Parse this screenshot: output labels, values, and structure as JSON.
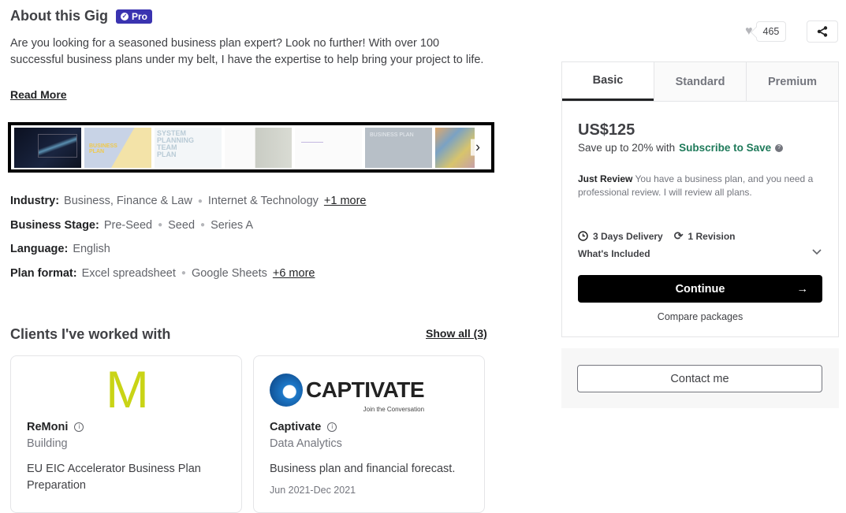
{
  "about": {
    "title": "About this Gig",
    "badge": "Pro",
    "description": "Are you looking for a seasoned business plan expert? Look no further! With over 100 successful business plans under my belt, I have the expertise to help bring your project to life.",
    "read_more": "Read More"
  },
  "gallery": {
    "thumbnails": [
      "video-trading-chart",
      "business-plan-cover",
      "word-cloud-plan",
      "investment-proposal",
      "product-traction-doc",
      "business-plan-startup",
      "risk-management"
    ],
    "next_icon": "chevron-right-icon"
  },
  "attributes": [
    {
      "label": "Industry:",
      "values": [
        "Business, Finance & Law",
        "Internet & Technology"
      ],
      "more": "+1 more"
    },
    {
      "label": "Business Stage:",
      "values": [
        "Pre-Seed",
        "Seed",
        "Series A"
      ],
      "more": ""
    },
    {
      "label": "Language:",
      "values": [
        "English"
      ],
      "more": ""
    },
    {
      "label": "Plan format:",
      "values": [
        "Excel spreadsheet",
        "Google Sheets"
      ],
      "more": "+6 more"
    }
  ],
  "clients": {
    "title": "Clients I've worked with",
    "show_all": "Show all (3)",
    "items": [
      {
        "logo_text": "M",
        "name": "ReMoni",
        "industry": "Building",
        "description": "EU EIC Accelerator Business Plan Preparation",
        "date": ""
      },
      {
        "logo_text": "CAPTIVATE",
        "logo_sub": "Join the Conversation",
        "name": "Captivate",
        "industry": "Data Analytics",
        "description": "Business plan and financial forecast.",
        "date": "Jun 2021-Dec 2021"
      }
    ]
  },
  "actions": {
    "likes": "465"
  },
  "package": {
    "tabs": [
      "Basic",
      "Standard",
      "Premium"
    ],
    "active_tab": "Basic",
    "price": "US$125",
    "save_prefix": "Save up to 20% with",
    "save_link": "Subscribe to Save",
    "title": "Just Review",
    "description": "You have a business plan, and you need a professional review. I will review all plans.",
    "delivery": "3 Days Delivery",
    "revisions": "1 Revision",
    "whats_included": "What's Included",
    "continue": "Continue",
    "compare": "Compare packages"
  },
  "contact": {
    "label": "Contact me"
  },
  "colors": {
    "pro_badge": "#3a33b0",
    "subscribe_link": "#1e7a5a",
    "primary_button": "#000000"
  }
}
